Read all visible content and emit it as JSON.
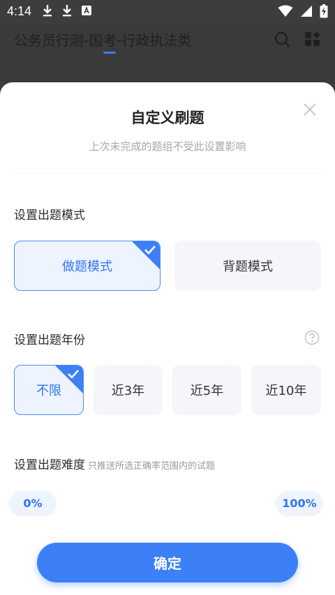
{
  "status_bar": {
    "time": "4:14"
  },
  "header": {
    "title": "公务员行测-国考-行政执法类"
  },
  "sheet": {
    "title": "自定义刷题",
    "subtitle": "上次未完成的题组不受此设置影响"
  },
  "mode_section": {
    "label": "设置出题模式",
    "options": [
      {
        "label": "做题模式",
        "selected": true
      },
      {
        "label": "背题模式",
        "selected": false
      }
    ]
  },
  "year_section": {
    "label": "设置出题年份",
    "options": [
      {
        "label": "不限",
        "selected": true
      },
      {
        "label": "近3年",
        "selected": false
      },
      {
        "label": "近5年",
        "selected": false
      },
      {
        "label": "近10年",
        "selected": false
      }
    ]
  },
  "difficulty_section": {
    "label": "设置出题难度",
    "hint": "只推送所选正确率范围内的试题",
    "min": "0%",
    "max": "100%"
  },
  "confirm_label": "确定",
  "colors": {
    "accent": "#3d7ff7",
    "selected_bg": "#eef4ff",
    "option_bg": "#f5f6fa"
  }
}
